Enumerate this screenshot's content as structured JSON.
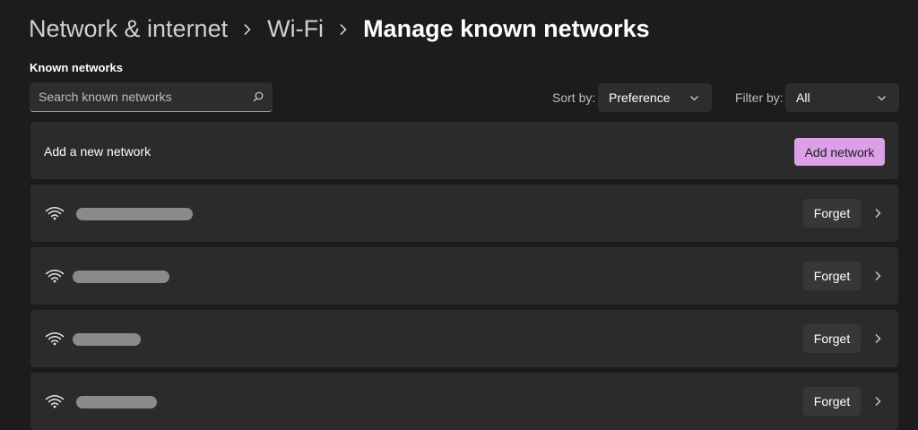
{
  "breadcrumb": {
    "items": [
      "Network & internet",
      "Wi-Fi"
    ],
    "current": "Manage known networks"
  },
  "known_networks": {
    "label": "Known networks",
    "search_placeholder": "Search known networks"
  },
  "sort": {
    "label": "Sort by:",
    "value": "Preference"
  },
  "filter": {
    "label": "Filter by:",
    "value": "All"
  },
  "add_network": {
    "text": "Add a new network",
    "button_label": "Add network",
    "button_color": "#dba0e8"
  },
  "networks": [
    {
      "name_redacted": true,
      "forget_label": "Forget"
    },
    {
      "name_redacted": true,
      "forget_label": "Forget"
    },
    {
      "name_redacted": true,
      "forget_label": "Forget"
    },
    {
      "name_redacted": true,
      "forget_label": "Forget"
    }
  ],
  "icons": {
    "search": "search-icon",
    "dropdown": "chevron-down-icon",
    "breadcrumb_separator": "chevron-right-icon",
    "network": "wifi-icon",
    "row_expand": "chevron-right-icon"
  }
}
